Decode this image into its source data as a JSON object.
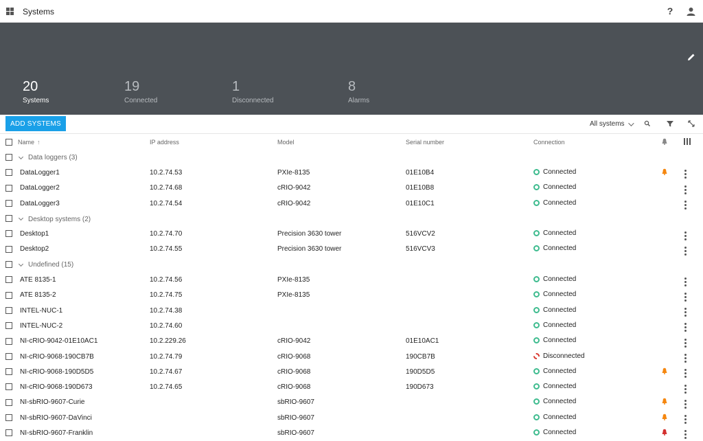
{
  "header": {
    "title": "Systems"
  },
  "summary": {
    "stats": [
      {
        "value": "20",
        "label": "Systems"
      },
      {
        "value": "19",
        "label": "Connected"
      },
      {
        "value": "1",
        "label": "Disconnected"
      },
      {
        "value": "8",
        "label": "Alarms"
      }
    ]
  },
  "toolbar": {
    "add_label": "ADD SYSTEMS",
    "filter_label": "All systems"
  },
  "columns": {
    "name": "Name",
    "ip": "IP address",
    "model": "Model",
    "serial": "Serial number",
    "connection": "Connection"
  },
  "colors": {
    "accent": "#1aa0e8",
    "connected": "#3dbb8e",
    "disconnected": "#d9342b",
    "alarm_orange": "#f5870f",
    "alarm_red": "#d3302f",
    "summary_bg": "#4c5156"
  },
  "rows": [
    {
      "type": "group",
      "label": "Data loggers (3)"
    },
    {
      "type": "system",
      "name": "DataLogger1",
      "ip": "10.2.74.53",
      "model": "PXIe-8135",
      "serial": "01E10B4",
      "status": "Connected",
      "state": "ok",
      "alarm": "orange"
    },
    {
      "type": "system",
      "name": "DataLogger2",
      "ip": "10.2.74.68",
      "model": "cRIO-9042",
      "serial": "01E10B8",
      "status": "Connected",
      "state": "ok",
      "alarm": ""
    },
    {
      "type": "system",
      "name": "DataLogger3",
      "ip": "10.2.74.54",
      "model": "cRIO-9042",
      "serial": "01E10C1",
      "status": "Connected",
      "state": "ok",
      "alarm": ""
    },
    {
      "type": "group",
      "label": "Desktop systems (2)"
    },
    {
      "type": "system",
      "name": "Desktop1",
      "ip": "10.2.74.70",
      "model": "Precision 3630 tower",
      "serial": "516VCV2",
      "status": "Connected",
      "state": "ok",
      "alarm": ""
    },
    {
      "type": "system",
      "name": "Desktop2",
      "ip": "10.2.74.55",
      "model": "Precision 3630 tower",
      "serial": "516VCV3",
      "status": "Connected",
      "state": "ok",
      "alarm": ""
    },
    {
      "type": "group",
      "label": "Undefined (15)"
    },
    {
      "type": "system",
      "name": "ATE 8135-1",
      "ip": "10.2.74.56",
      "model": "PXIe-8135",
      "serial": "",
      "status": "Connected",
      "state": "ok",
      "alarm": ""
    },
    {
      "type": "system",
      "name": "ATE 8135-2",
      "ip": "10.2.74.75",
      "model": "PXIe-8135",
      "serial": "",
      "status": "Connected",
      "state": "ok",
      "alarm": ""
    },
    {
      "type": "system",
      "name": "INTEL-NUC-1",
      "ip": "10.2.74.38",
      "model": "",
      "serial": "",
      "status": "Connected",
      "state": "ok",
      "alarm": ""
    },
    {
      "type": "system",
      "name": "INTEL-NUC-2",
      "ip": "10.2.74.60",
      "model": "",
      "serial": "",
      "status": "Connected",
      "state": "ok",
      "alarm": ""
    },
    {
      "type": "system",
      "name": "NI-cRIO-9042-01E10AC1",
      "ip": "10.2.229.26",
      "model": "cRIO-9042",
      "serial": "01E10AC1",
      "status": "Connected",
      "state": "ok",
      "alarm": ""
    },
    {
      "type": "system",
      "name": "NI-cRIO-9068-190CB7B",
      "ip": "10.2.74.79",
      "model": "cRIO-9068",
      "serial": "190CB7B",
      "status": "Disconnected",
      "state": "bad",
      "alarm": ""
    },
    {
      "type": "system",
      "name": "NI-cRIO-9068-190D5D5",
      "ip": "10.2.74.67",
      "model": "cRIO-9068",
      "serial": "190D5D5",
      "status": "Connected",
      "state": "ok",
      "alarm": "orange"
    },
    {
      "type": "system",
      "name": "NI-cRIO-9068-190D673",
      "ip": "10.2.74.65",
      "model": "cRIO-9068",
      "serial": "190D673",
      "status": "Connected",
      "state": "ok",
      "alarm": ""
    },
    {
      "type": "system",
      "name": "NI-sbRIO-9607-Curie",
      "ip": "",
      "model": "sbRIO-9607",
      "serial": "",
      "status": "Connected",
      "state": "ok",
      "alarm": "orange"
    },
    {
      "type": "system",
      "name": "NI-sbRIO-9607-DaVinci",
      "ip": "",
      "model": "sbRIO-9607",
      "serial": "",
      "status": "Connected",
      "state": "ok",
      "alarm": "orange"
    },
    {
      "type": "system",
      "name": "NI-sbRIO-9607-Franklin",
      "ip": "",
      "model": "sbRIO-9607",
      "serial": "",
      "status": "Connected",
      "state": "ok",
      "alarm": "red"
    }
  ]
}
